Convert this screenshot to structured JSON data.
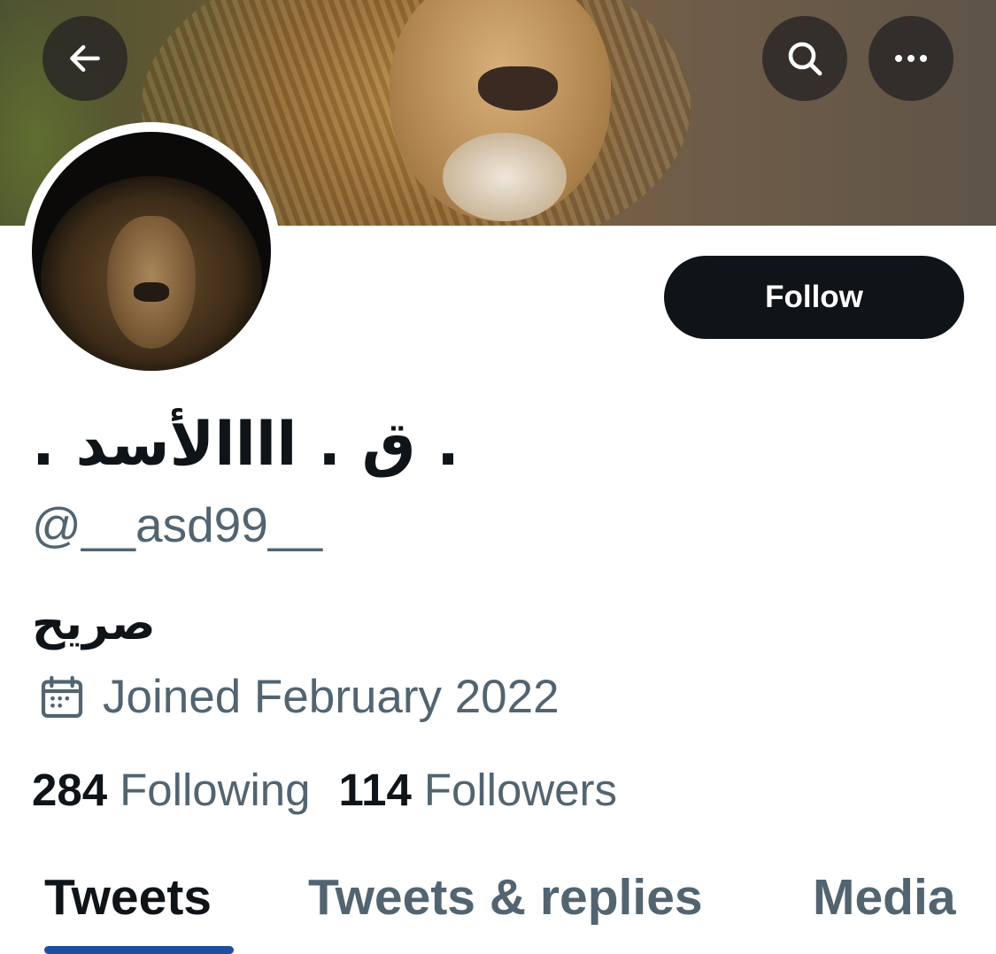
{
  "banner": {
    "image": "lion-photo-banner"
  },
  "nav": {
    "back_icon": "arrow-left-icon",
    "search_icon": "search-icon",
    "more_icon": "more-horizontal-icon"
  },
  "profile": {
    "avatar": "lion-avatar",
    "display_name": ". ق . اااالأسد .",
    "handle": "@__asd99__",
    "bio": "صريح",
    "joined": "Joined February 2022",
    "joined_icon": "calendar-icon"
  },
  "actions": {
    "follow_label": "Follow"
  },
  "stats": {
    "following_count": "284",
    "following_label": "Following",
    "followers_count": "114",
    "followers_label": "Followers"
  },
  "tabs": [
    {
      "label": "Tweets",
      "active": true
    },
    {
      "label": "Tweets & replies",
      "active": false
    },
    {
      "label": "Media",
      "active": false
    }
  ],
  "colors": {
    "primary_text": "#0f1419",
    "secondary_text": "#536471",
    "button_bg": "#0f1419",
    "tab_indicator": "#1d4fa0"
  }
}
